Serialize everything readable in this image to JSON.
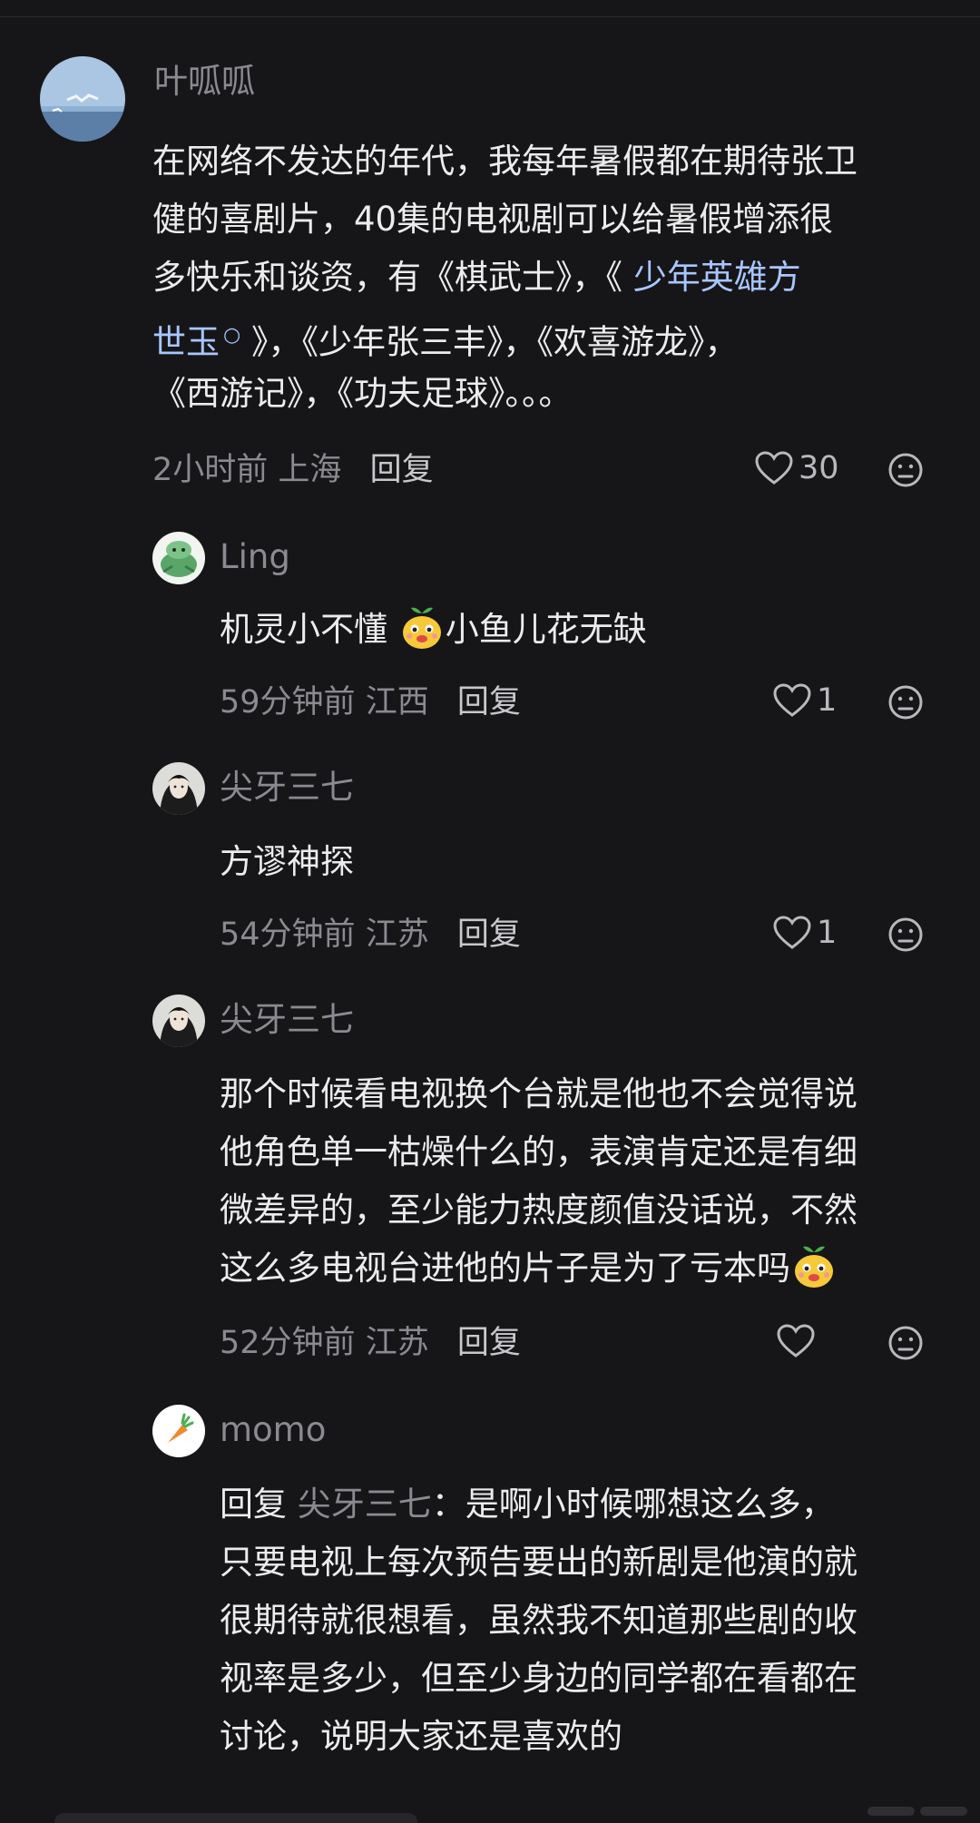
{
  "comments": [
    {
      "author": "叶呱呱",
      "lines": [
        "在网络不发达的年代，我每年暑假都在期待张卫",
        "健的喜剧片，40集的电视剧可以给暑假增添很",
        "多快乐和谈资，有《棋武士》，《",
        "》，《少年张三丰》，《欢喜游龙》，",
        "《西游记》，《功夫足球》。。。"
      ],
      "link_text_1": "少年英雄方",
      "link_text_2": "世玉",
      "link_icon": "search-link-icon",
      "time": "2小时前",
      "location": "上海",
      "reply_label": "回复",
      "likes": "30"
    },
    {
      "author": "Ling",
      "text_before": "机灵小不懂",
      "emoji": "sprout-face-emoji",
      "text_after": "小鱼儿花无缺",
      "time": "59分钟前",
      "location": "江西",
      "reply_label": "回复",
      "likes": "1"
    },
    {
      "author": "尖牙三七",
      "text": "方谬神探",
      "time": "54分钟前",
      "location": "江苏",
      "reply_label": "回复",
      "likes": "1"
    },
    {
      "author": "尖牙三七",
      "lines": [
        "那个时候看电视换个台就是他也不会觉得说",
        "他角色单一枯燥什么的，表演肯定还是有细",
        "微差异的，至少能力热度颜值没话说，不然",
        "这么多电视台进他的片子是为了亏本吗"
      ],
      "emoji": "sprout-face-emoji",
      "time": "52分钟前",
      "location": "江苏",
      "reply_label": "回复",
      "likes": ""
    },
    {
      "author": "momo",
      "reply_prefix": "回复",
      "reply_to": "尖牙三七",
      "first_line_rest": "：是啊小时候哪想这么多，",
      "lines": [
        "只要电视上每次预告要出的新剧是他演的就",
        "很期待就很想看，虽然我不知道那些剧的收",
        "视率是多少，但至少身边的同学都在看都在",
        "讨论，说明大家还是喜欢的"
      ]
    }
  ],
  "colors": {
    "background": "#161619",
    "text": "#ececec",
    "muted": "#8a8a90",
    "link": "#a9c6ff"
  }
}
